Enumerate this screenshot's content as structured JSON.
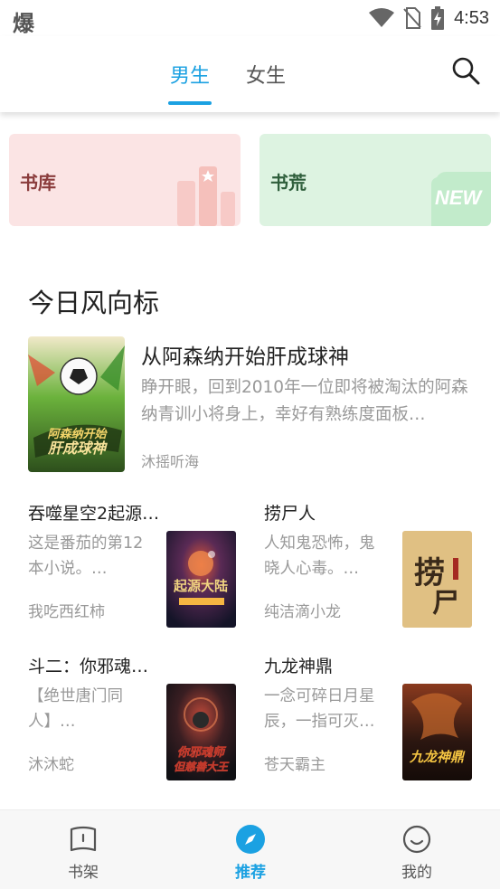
{
  "status_bar": {
    "left_glyph": "爆",
    "time": "4:53",
    "icons": [
      "wifi-icon",
      "no-sim-icon",
      "battery-charging-icon"
    ]
  },
  "header": {
    "tabs": [
      {
        "label": "男生",
        "active": true
      },
      {
        "label": "女生",
        "active": false
      }
    ],
    "search_icon": "search-icon",
    "accent_color": "#1ba1e2"
  },
  "categories": [
    {
      "label": "书库",
      "color": "#fbe4e4"
    },
    {
      "label": "书荒",
      "color": "#ddf3e1",
      "badge": "NEW"
    }
  ],
  "section": {
    "title": "今日风向标",
    "featured": {
      "title": "从阿森纳开始肝成球神",
      "description": "睁开眼，回到2010年一位即将被淘汰的阿森纳青训小将身上，幸好有熟练度面板…",
      "author": "沐摇听海"
    },
    "books": [
      {
        "title": "吞噬星空2起源…",
        "description": "这是番茄的第12本小说。…",
        "author": "我吃西红柿"
      },
      {
        "title": "捞尸人",
        "description": "人知鬼恐怖，鬼晓人心毒。…",
        "author": "纯洁滴小龙"
      },
      {
        "title": "斗二：你邪魂…",
        "description": "【绝世唐门同人】…",
        "author": "沐沐蛇"
      },
      {
        "title": "九龙神鼎",
        "description": "一念可碎日月星辰，一指可灭…",
        "author": "苍天霸主"
      }
    ]
  },
  "bottom_nav": [
    {
      "label": "书架",
      "icon": "bookshelf-icon",
      "active": false
    },
    {
      "label": "推荐",
      "icon": "compass-icon",
      "active": true
    },
    {
      "label": "我的",
      "icon": "smiley-icon",
      "active": false
    }
  ]
}
